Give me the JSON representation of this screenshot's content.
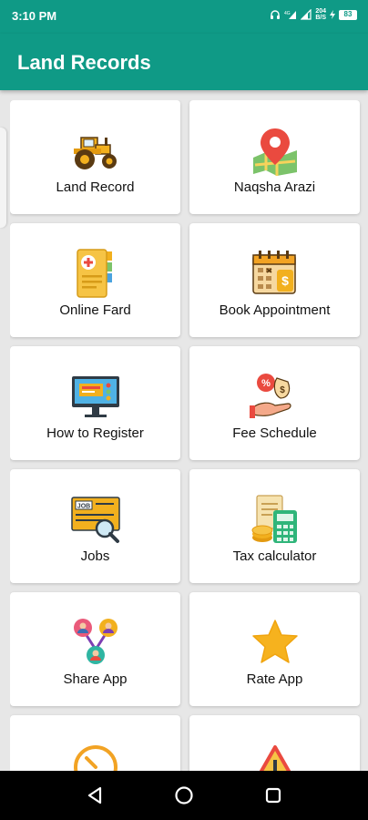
{
  "status": {
    "time": "3:10 PM",
    "net_speed": "204",
    "net_unit": "B/S",
    "battery": "83"
  },
  "app": {
    "title": "Land Records"
  },
  "menu": [
    {
      "label": "Land Record",
      "icon": "tractor-icon"
    },
    {
      "label": "Naqsha Arazi",
      "icon": "map-pin-icon"
    },
    {
      "label": "Online Fard",
      "icon": "document-icon"
    },
    {
      "label": "Book Appointment",
      "icon": "calendar-icon"
    },
    {
      "label": "How to Register",
      "icon": "monitor-icon"
    },
    {
      "label": "Fee Schedule",
      "icon": "money-hand-icon"
    },
    {
      "label": "Jobs",
      "icon": "job-search-icon"
    },
    {
      "label": "Tax calculator",
      "icon": "calculator-icon"
    },
    {
      "label": "Share App",
      "icon": "share-network-icon"
    },
    {
      "label": "Rate App",
      "icon": "star-icon"
    },
    {
      "label": "",
      "icon": "clock-icon"
    },
    {
      "label": "",
      "icon": "warning-icon"
    }
  ],
  "colors": {
    "primary": "#0f9a86",
    "background": "#e7e7e7",
    "card": "#ffffff",
    "nav": "#000000"
  }
}
